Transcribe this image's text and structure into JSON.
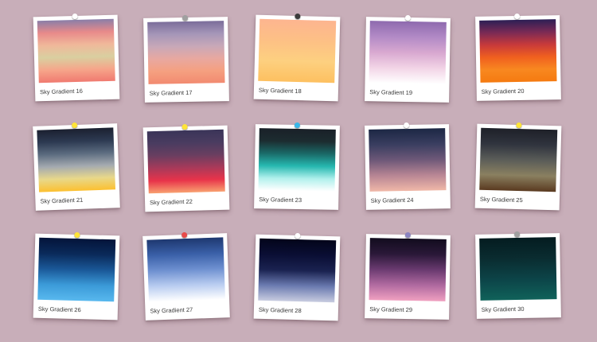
{
  "background_color": "#c8aeb9",
  "cards": [
    {
      "label": "Sky Gradient 16",
      "pin_color": "#ffffff",
      "gradient": [
        "#8a7ea8",
        "#e88a8a",
        "#f0b89a",
        "#d9cfa0",
        "#f6a58a",
        "#f07a70"
      ]
    },
    {
      "label": "Sky Gradient 17",
      "pin_color": "#a0a0a0",
      "gradient": [
        "#7b6d9a",
        "#a596b8",
        "#c8a8b8",
        "#e8a8a0",
        "#f5a080",
        "#f28a70"
      ]
    },
    {
      "label": "Sky Gradient 18",
      "pin_color": "#3b3b3b",
      "gradient": [
        "#fdb590",
        "#fdc085",
        "#fdd080",
        "#fdc060"
      ]
    },
    {
      "label": "Sky Gradient 19",
      "pin_color": "#ffffff",
      "gradient": [
        "#8e6aae",
        "#b28ac6",
        "#d8a8d0",
        "#f2d4e6",
        "#ffffff"
      ]
    },
    {
      "label": "Sky Gradient 20",
      "pin_color": "#ffffff",
      "gradient": [
        "#2c1f55",
        "#7a2a55",
        "#c83a3a",
        "#f0601f",
        "#f88820",
        "#f57a10"
      ]
    },
    {
      "label": "Sky Gradient 21",
      "pin_color": "#ffe438",
      "gradient": [
        "#1b2030",
        "#2d3a52",
        "#5c6c80",
        "#a4aab0",
        "#e8d88a",
        "#fcc030"
      ]
    },
    {
      "label": "Sky Gradient 22",
      "pin_color": "#ffe438",
      "gradient": [
        "#3a3458",
        "#4a3c60",
        "#6a3e60",
        "#a83a5a",
        "#e8334a",
        "#f8a070"
      ]
    },
    {
      "label": "Sky Gradient 23",
      "pin_color": "#39b7e8",
      "gradient": [
        "#1a2028",
        "#1c2c30",
        "#1a6a68",
        "#26b8b0",
        "#b0f0ec",
        "#ffffff"
      ]
    },
    {
      "label": "Sky Gradient 24",
      "pin_color": "#ffffff",
      "gradient": [
        "#1c2744",
        "#3a3e60",
        "#6e5878",
        "#b88694",
        "#f0b8a8"
      ]
    },
    {
      "label": "Sky Gradient 25",
      "pin_color": "#ffe438",
      "gradient": [
        "#1e2028",
        "#30343e",
        "#5a5c58",
        "#8a8060",
        "#5a3a20"
      ]
    },
    {
      "label": "Sky Gradient 26",
      "pin_color": "#ffe438",
      "gradient": [
        "#04143a",
        "#0a2a5a",
        "#1a5898",
        "#3b9ad8",
        "#58b8ee"
      ]
    },
    {
      "label": "Sky Gradient 27",
      "pin_color": "#e84a4a",
      "gradient": [
        "#1e3870",
        "#3a60a8",
        "#6e90d0",
        "#b8ccf0",
        "#ffffff"
      ]
    },
    {
      "label": "Sky Gradient 28",
      "pin_color": "#ffffff",
      "gradient": [
        "#03051a",
        "#0a0e34",
        "#1a2250",
        "#6a7ab0",
        "#c8cce0"
      ]
    },
    {
      "label": "Sky Gradient 29",
      "pin_color": "#8b84c2",
      "gradient": [
        "#120c1e",
        "#2a1838",
        "#6a3a70",
        "#b06aa0",
        "#f0a0c0"
      ]
    },
    {
      "label": "Sky Gradient 30",
      "pin_color": "#a0a0a0",
      "gradient": [
        "#041c20",
        "#0a2c30",
        "#0c4448",
        "#10625a"
      ]
    }
  ]
}
